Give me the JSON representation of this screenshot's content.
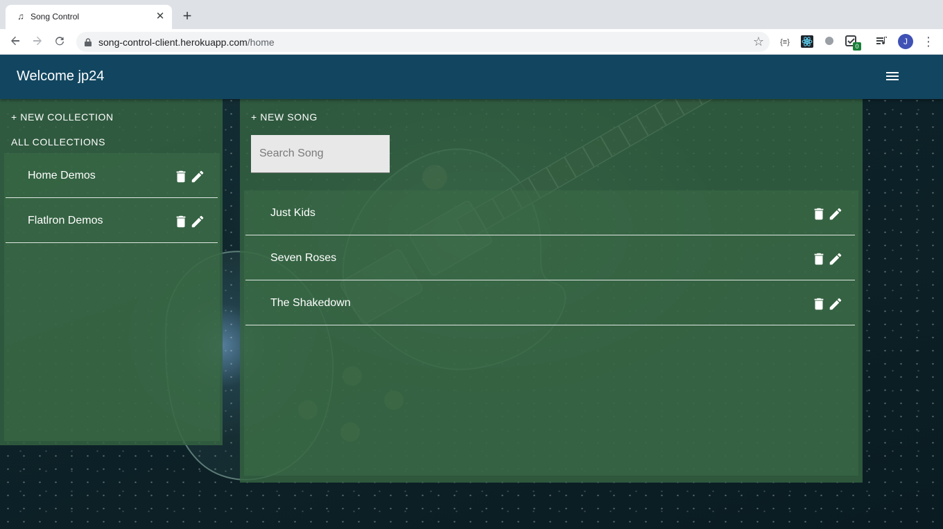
{
  "browser": {
    "tab_title": "Song Control",
    "tab_favicon": "♫",
    "tab_close": "✕",
    "new_tab": "+",
    "url_host": "song-control-client.herokuapp.com",
    "url_path": "/home",
    "profile_initial": "J",
    "extension_badge": "0",
    "extension_json_label": "{≡}"
  },
  "header": {
    "welcome": "Welcome jp24"
  },
  "collections": {
    "new_label": "+ NEW COLLECTION",
    "all_label": "ALL COLLECTIONS",
    "items": [
      {
        "label": "Home Demos"
      },
      {
        "label": "Flatlron Demos"
      }
    ]
  },
  "songs": {
    "new_label": "+ NEW SONG",
    "search_placeholder": "Search Song",
    "items": [
      {
        "label": "Just Kids"
      },
      {
        "label": "Seven Roses"
      },
      {
        "label": "The Shakedown"
      }
    ]
  },
  "icons": {
    "delete": "trash-icon",
    "edit": "pencil-icon",
    "menu": "hamburger-menu-icon"
  }
}
